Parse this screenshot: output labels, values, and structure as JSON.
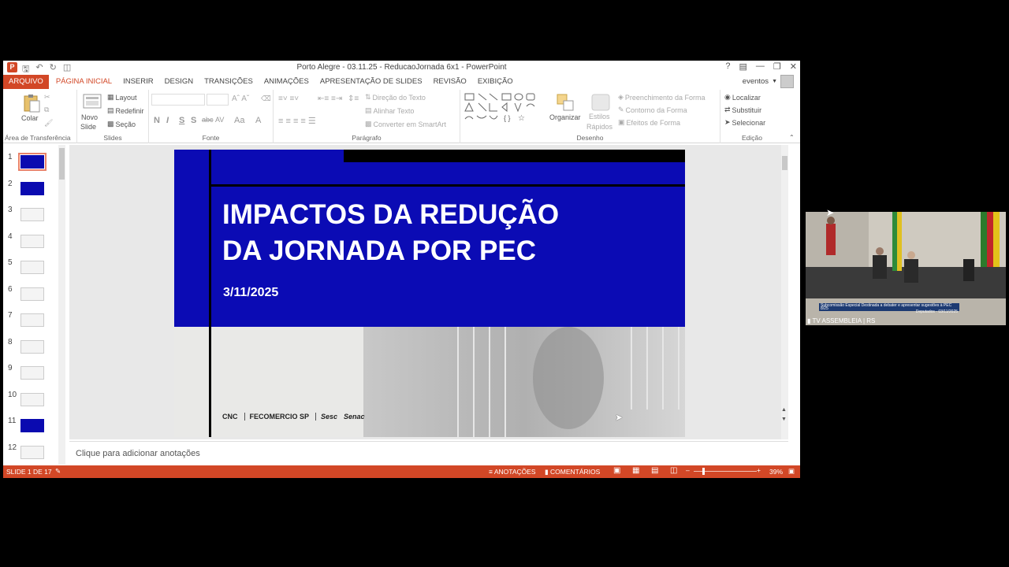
{
  "window": {
    "title": "Porto Alegre - 03.11.25 - ReducaoJornada 6x1 - PowerPoint",
    "help": "?",
    "user": "eventos"
  },
  "ribbon_tabs": [
    "ARQUIVO",
    "PÁGINA INICIAL",
    "INSERIR",
    "DESIGN",
    "TRANSIÇÕES",
    "ANIMAÇÕES",
    "APRESENTAÇÃO DE SLIDES",
    "REVISÃO",
    "EXIBIÇÃO"
  ],
  "ribbon": {
    "clipboard": {
      "paste": "Colar",
      "group": "Área de Transferência"
    },
    "slides": {
      "new_slide_1": "Novo",
      "new_slide_2": "Slide",
      "layout": "Layout",
      "reset": "Redefinir",
      "section": "Seção",
      "group": "Slides"
    },
    "font": {
      "bold": "N",
      "italic": "I",
      "underline": "S",
      "shadow": "S",
      "strike": "abc",
      "spacing": "AV",
      "case": "Aa",
      "color": "A",
      "group": "Fonte"
    },
    "paragraph": {
      "text_direction": "Direção do Texto",
      "align_text": "Alinhar Texto",
      "smartart": "Converter em SmartArt",
      "group": "Parágrafo"
    },
    "drawing": {
      "arrange": "Organizar",
      "quick_styles_1": "Estilos",
      "quick_styles_2": "Rápidos",
      "fill": "Preenchimento da Forma",
      "outline": "Contorno da Forma",
      "effects": "Efeitos de Forma",
      "group": "Desenho"
    },
    "editing": {
      "find": "Localizar",
      "replace": "Substituir",
      "select": "Selecionar",
      "group": "Edição"
    }
  },
  "thumbnails": [
    {
      "num": "1",
      "style": "blue"
    },
    {
      "num": "2",
      "style": "blue"
    },
    {
      "num": "3",
      "style": "light"
    },
    {
      "num": "4",
      "style": "light"
    },
    {
      "num": "5",
      "style": "light"
    },
    {
      "num": "6",
      "style": "light"
    },
    {
      "num": "7",
      "style": "light"
    },
    {
      "num": "8",
      "style": "light"
    },
    {
      "num": "9",
      "style": "light"
    },
    {
      "num": "10",
      "style": "light"
    },
    {
      "num": "11",
      "style": "blue"
    },
    {
      "num": "12",
      "style": "light"
    }
  ],
  "slide": {
    "title_line1": "IMPACTOS DA REDUÇÃO",
    "title_line2": "DA JORNADA POR PEC",
    "date": "3/11/2025",
    "logos": {
      "cnc": "CNC",
      "fecomercio": "FECOMERCIO SP",
      "sesc": "Sesc",
      "senac": "Senac"
    },
    "primary_color": "#0b0bb4"
  },
  "notes_placeholder": "Clique para adicionar anotações",
  "status": {
    "slide_info": "SLIDE 1 DE 17",
    "notes": "ANOTAÇÕES",
    "comments": "COMENTÁRIOS",
    "zoom": "39%"
  },
  "camera": {
    "lower_third": "Subcomissão Especial Destinada a debater e apresentar sugestões à PEC 8/25",
    "lower_third_2": "Deputados - 03/11/2025",
    "label": "TV ASSEMBLEIA | RS"
  }
}
